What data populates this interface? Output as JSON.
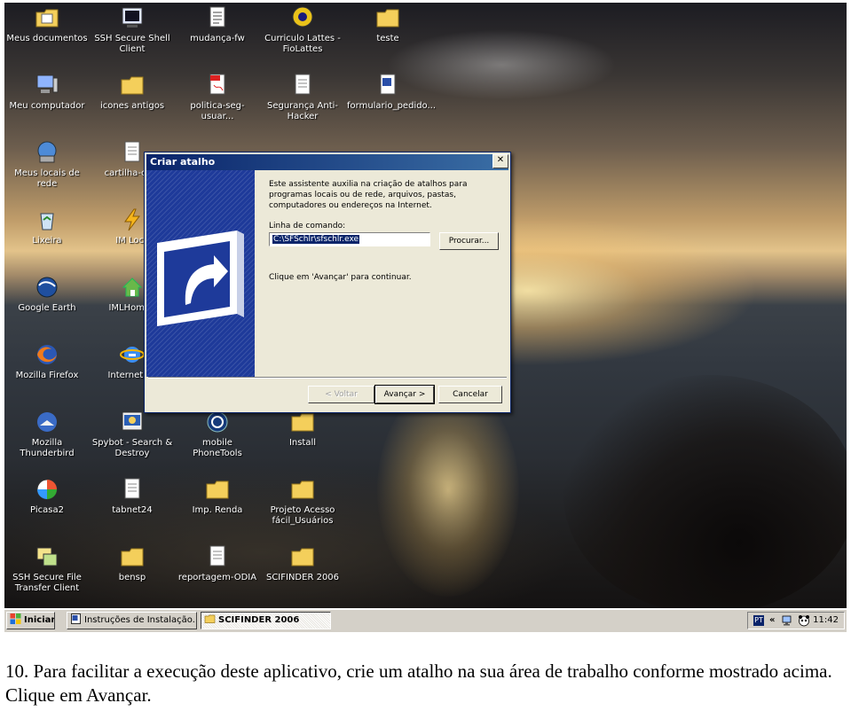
{
  "desktop": {
    "icons": [
      {
        "label": "Meus documentos",
        "icon": "folder-documents-icon"
      },
      {
        "label": "SSH Secure Shell Client",
        "icon": "terminal-icon"
      },
      {
        "label": "mudança-fw",
        "icon": "text-file-icon"
      },
      {
        "label": "Curriculo Lattes - FioLattes",
        "icon": "lattes-icon"
      },
      {
        "label": "teste",
        "icon": "folder-icon"
      },
      {
        "label": "Meu computador",
        "icon": "computer-icon"
      },
      {
        "label": "icones antigos",
        "icon": "folder-icon"
      },
      {
        "label": "politica-seg-usuar...",
        "icon": "pdf-icon"
      },
      {
        "label": "Segurança Anti-Hacker",
        "icon": "document-icon"
      },
      {
        "label": "formulario_pedido...",
        "icon": "word-doc-icon"
      },
      {
        "label": "Meus locais de rede",
        "icon": "network-icon"
      },
      {
        "label": "cartilha-com",
        "icon": "document-icon"
      },
      {
        "label": "Lixeira",
        "icon": "recycle-bin-icon"
      },
      {
        "label": "IM Lock",
        "icon": "lightning-icon"
      },
      {
        "label": "Google Earth",
        "icon": "globe-icon"
      },
      {
        "label": "IMLHomeS",
        "icon": "house-icon"
      },
      {
        "label": "Mozilla Firefox",
        "icon": "firefox-icon"
      },
      {
        "label": "Internet Ex",
        "icon": "internet-explorer-icon"
      },
      {
        "label": "Mozilla Thunderbird",
        "icon": "thunderbird-icon"
      },
      {
        "label": "Spybot - Search & Destroy",
        "icon": "spybot-icon"
      },
      {
        "label": "mobile PhoneTools",
        "icon": "phone-tools-icon"
      },
      {
        "label": "Install",
        "icon": "folder-icon"
      },
      {
        "label": "Picasa2",
        "icon": "picasa-icon"
      },
      {
        "label": "tabnet24",
        "icon": "document-icon"
      },
      {
        "label": "Imp. Renda",
        "icon": "folder-icon"
      },
      {
        "label": "Projeto Acesso fácil_Usuários",
        "icon": "folder-icon"
      },
      {
        "label": "SSH Secure File Transfer Client",
        "icon": "file-transfer-icon"
      },
      {
        "label": "bensp",
        "icon": "folder-icon"
      },
      {
        "label": "reportagem-ODIA",
        "icon": "document-icon"
      },
      {
        "label": "SCIFINDER 2006",
        "icon": "folder-icon"
      }
    ]
  },
  "dialog": {
    "title": "Criar atalho",
    "intro": "Este assistente auxilia na criação de atalhos para programas locais ou de rede, arquivos, pastas, computadores ou endereços na Internet.",
    "command_label": "Linha de comando:",
    "command_value": "C:\\SFSchlr\\sfschlr.exe",
    "browse_label": "Procurar...",
    "hint": "Clique em 'Avançar' para continuar.",
    "back_label": "< Voltar",
    "next_label": "Avançar >",
    "cancel_label": "Cancelar",
    "close_glyph": "✕"
  },
  "taskbar": {
    "start_label": "Iniciar",
    "tasks": [
      {
        "label": "Instruções de Instalação..."
      },
      {
        "label": "SCIFINDER 2006"
      }
    ],
    "language": "PT",
    "chevron": "«",
    "clock": "11:42"
  },
  "caption": "10. Para facilitar a execução deste aplicativo, crie um atalho na sua área de trabalho conforme mostrado acima. Clique em Avançar."
}
